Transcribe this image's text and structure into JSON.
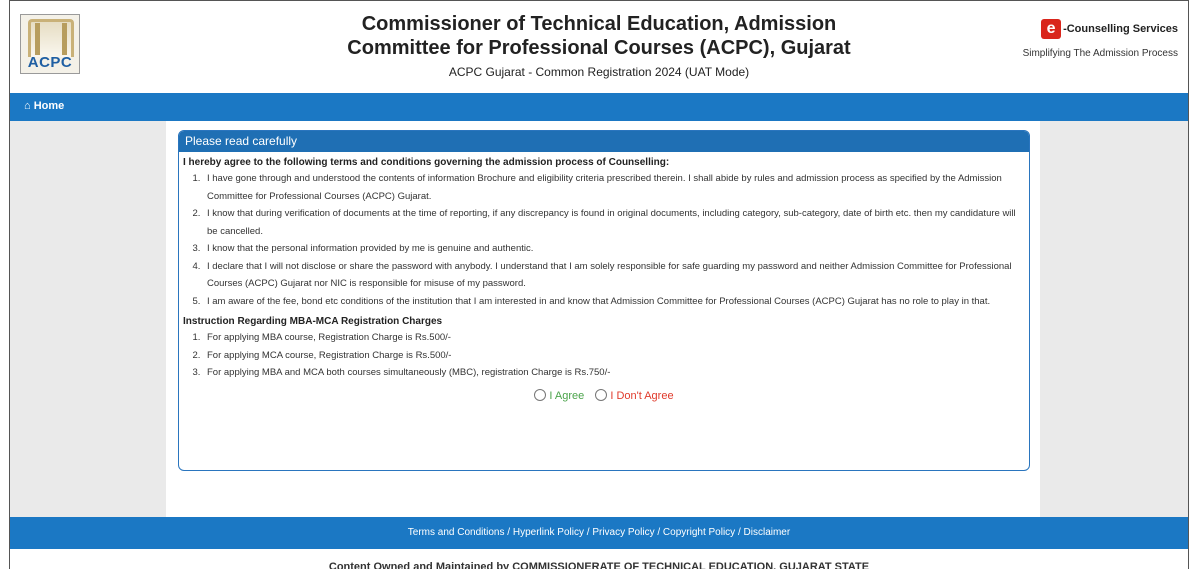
{
  "header": {
    "logo_text": "ACPC",
    "title_line1": "Commissioner of Technical Education, Admission",
    "title_line2": "Committee for Professional Courses (ACPC), Gujarat",
    "subtitle": "ACPC Gujarat - Common Registration 2024 (UAT Mode)",
    "ecounselling_name": "-Counselling Services",
    "ecounselling_tagline": "Simplifying The Admission Process"
  },
  "nav": {
    "home_label": "Home"
  },
  "panel": {
    "heading": "Please read carefully",
    "terms_title": "I hereby agree to the following terms and conditions governing the admission process of Counselling:",
    "terms": [
      "I have gone through and understood the contents of information Brochure and eligibility criteria prescribed therein. I shall abide by rules and admission process as specified by the Admission Committee for Professional Courses (ACPC) Gujarat.",
      "I know that during verification of documents at the time of reporting, if any discrepancy is found in original documents, including category, sub-category, date of birth etc. then my candidature will be cancelled.",
      "I know that the personal information provided by me is genuine and authentic.",
      "I declare that I will not disclose or share the password with anybody. I understand that I am solely responsible for safe guarding my password and neither Admission Committee for Professional Courses (ACPC) Gujarat nor NIC is responsible for misuse of my password.",
      "I am aware of the fee, bond etc conditions of the institution that I am interested in and know that Admission Committee for Professional Courses (ACPC) Gujarat has no role to play in that."
    ],
    "charges_title": "Instruction Regarding MBA-MCA Registration Charges",
    "charges": [
      "For applying MBA course, Registration Charge is Rs.500/-",
      "For applying MCA course, Registration Charge is Rs.500/-",
      "For applying MBA and MCA both courses simultaneously (MBC), registration Charge is Rs.750/-"
    ],
    "agree_label": "I Agree",
    "disagree_label": "I Don't Agree"
  },
  "footer": {
    "links": [
      "Terms and Conditions",
      "Hyperlink Policy",
      "Privacy Policy",
      "Copyright Policy",
      "Disclaimer"
    ],
    "separator": " / ",
    "owned_by": "Content Owned and Maintained by COMMISSIONERATE OF TECHNICAL EDUCATION, GUJARAT STATE"
  },
  "colors": {
    "primary_blue": "#1b78c4",
    "agree_green": "#4aa34a",
    "disagree_red": "#e03a2b"
  },
  "icons": {
    "home": "home-icon",
    "ecounselling": "e-logo-icon"
  }
}
